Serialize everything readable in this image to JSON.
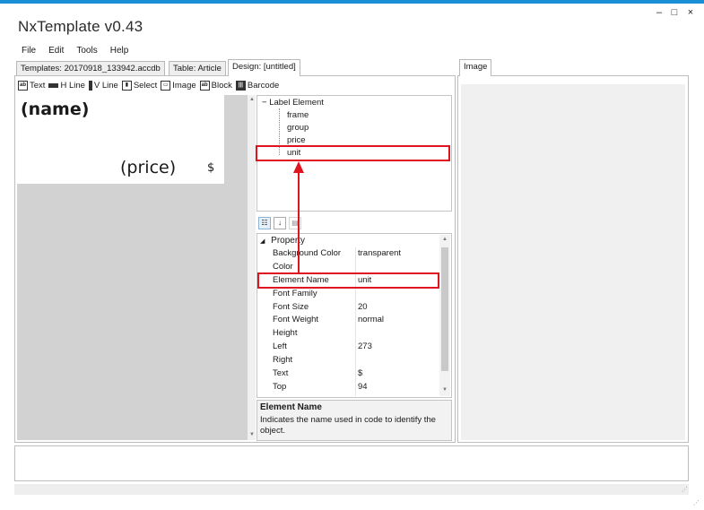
{
  "window": {
    "title": "NxTemplate v0.43",
    "minimize": "–",
    "maximize": "□",
    "close": "×"
  },
  "menu": [
    "File",
    "Edit",
    "Tools",
    "Help"
  ],
  "tabs": [
    {
      "label": "Templates: 20170918_133942.accdb"
    },
    {
      "label": "Table: Article"
    },
    {
      "label": "Design: [untitled]"
    }
  ],
  "image_tab": {
    "label": "Image"
  },
  "toolbar": {
    "text": "Text",
    "hline": "H Line",
    "vline": "V Line",
    "select": "Select",
    "image": "Image",
    "block": "Block",
    "barcode": "Barcode"
  },
  "canvas": {
    "name": "(name)",
    "price": "(price)",
    "unit": "$"
  },
  "tree": {
    "collapse": "−",
    "root": "Label Element",
    "children": [
      "frame",
      "group",
      "price",
      "unit"
    ]
  },
  "property_grid": {
    "category_arrow": "◢",
    "category": "Property",
    "rows": [
      {
        "name": "Background Color",
        "value": "transparent"
      },
      {
        "name": "Color",
        "value": ""
      },
      {
        "name": "Element Name",
        "value": "unit"
      },
      {
        "name": "Font Family",
        "value": ""
      },
      {
        "name": "Font Size",
        "value": "20"
      },
      {
        "name": "Font Weight",
        "value": "normal"
      },
      {
        "name": "Height",
        "value": ""
      },
      {
        "name": "Left",
        "value": "273"
      },
      {
        "name": "Right",
        "value": ""
      },
      {
        "name": "Text",
        "value": "$"
      },
      {
        "name": "Top",
        "value": "94"
      }
    ],
    "description_title": "Element Name",
    "description": "Indicates the name used in code to identify the object."
  },
  "colors": {
    "accent": "#1a8fd6",
    "highlight": "#e0141e",
    "canvas_bg": "#d2d2d2"
  }
}
